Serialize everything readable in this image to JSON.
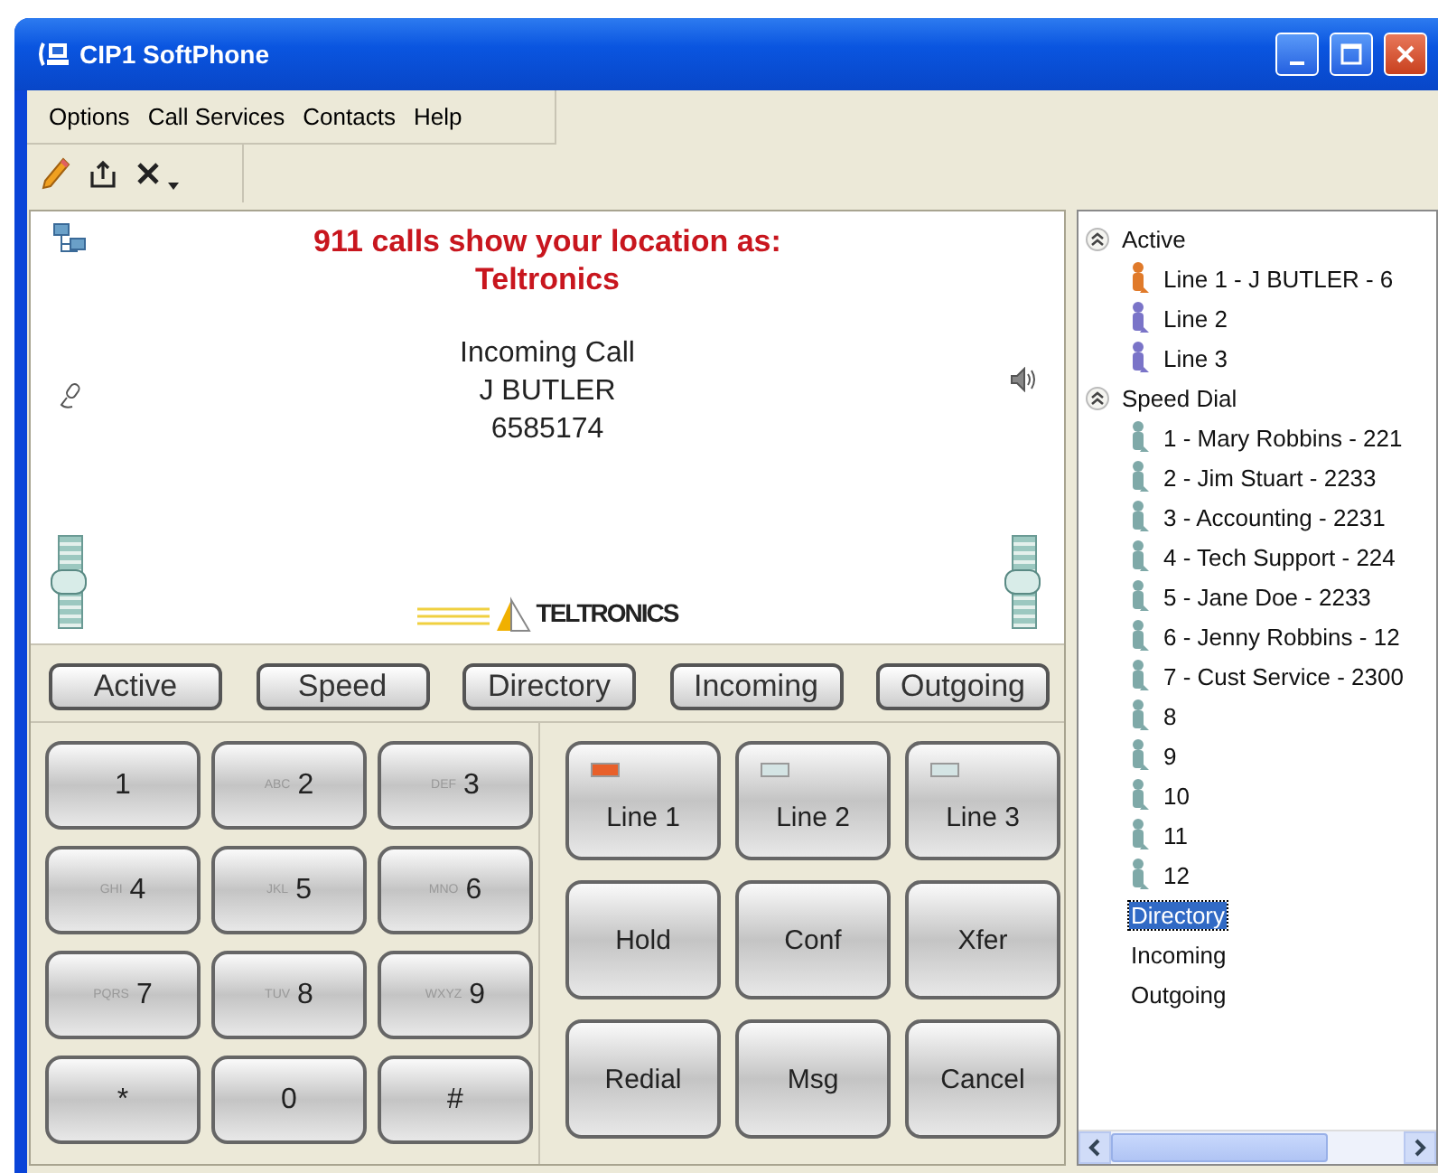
{
  "window": {
    "title": "CIP1 SoftPhone"
  },
  "menu": [
    "Options",
    "Call Services",
    "Contacts",
    "Help"
  ],
  "display": {
    "notice": "911 calls show your location as:",
    "location": "Teltronics",
    "status": "Incoming Call",
    "caller": "J BUTLER",
    "number": "6585174",
    "logo": "TELTRONICS",
    "mic_slider": {
      "level": 0.5
    },
    "speaker_slider": {
      "level": 0.5
    }
  },
  "view_buttons": [
    "Active",
    "Speed",
    "Directory",
    "Incoming",
    "Outgoing"
  ],
  "keypad": [
    {
      "digit": "1"
    },
    {
      "digit": "2",
      "letters": "ABC"
    },
    {
      "digit": "3",
      "letters": "DEF"
    },
    {
      "digit": "4",
      "letters": "GHI"
    },
    {
      "digit": "5",
      "letters": "JKL"
    },
    {
      "digit": "6",
      "letters": "MNO"
    },
    {
      "digit": "7",
      "letters": "PQRS"
    },
    {
      "digit": "8",
      "letters": "TUV"
    },
    {
      "digit": "9",
      "letters": "WXYZ"
    },
    {
      "digit": "*"
    },
    {
      "digit": "0"
    },
    {
      "digit": "#"
    }
  ],
  "line_buttons": [
    {
      "label": "Line 1",
      "lit": true
    },
    {
      "label": "Line 2",
      "lit": false
    },
    {
      "label": "Line 3",
      "lit": false
    }
  ],
  "call_buttons": [
    "Hold",
    "Conf",
    "Xfer",
    "Redial",
    "Msg",
    "Cancel"
  ],
  "tree": [
    {
      "label": "Active",
      "expanded": true,
      "selected": false,
      "children": [
        {
          "label": "Line 1 - J BUTLER - 6",
          "color": "#e07a2a",
          "selected": false
        },
        {
          "label": "Line 2",
          "color": "#7a74c8",
          "selected": false
        },
        {
          "label": "Line 3",
          "color": "#7a74c8",
          "selected": false
        }
      ]
    },
    {
      "label": "Speed Dial",
      "expanded": true,
      "selected": false,
      "children": [
        {
          "label": "1 - Mary Robbins - 221",
          "color": "#7fa9a8",
          "selected": false
        },
        {
          "label": "2 - Jim Stuart - 2233",
          "color": "#7fa9a8",
          "selected": false
        },
        {
          "label": "3 - Accounting - 2231",
          "color": "#7fa9a8",
          "selected": false
        },
        {
          "label": "4 - Tech Support - 224",
          "color": "#7fa9a8",
          "selected": false
        },
        {
          "label": "5 - Jane Doe - 2233",
          "color": "#7fa9a8",
          "selected": false
        },
        {
          "label": "6 - Jenny Robbins - 12",
          "color": "#7fa9a8",
          "selected": false
        },
        {
          "label": "7 - Cust Service - 2300",
          "color": "#7fa9a8",
          "selected": false
        },
        {
          "label": "8",
          "color": "#7fa9a8",
          "selected": false
        },
        {
          "label": "9",
          "color": "#7fa9a8",
          "selected": false
        },
        {
          "label": "10",
          "color": "#7fa9a8",
          "selected": false
        },
        {
          "label": "11",
          "color": "#7fa9a8",
          "selected": false
        },
        {
          "label": "12",
          "color": "#7fa9a8",
          "selected": false
        }
      ]
    },
    {
      "label": "Directory",
      "selected": true
    },
    {
      "label": "Incoming",
      "selected": false
    },
    {
      "label": "Outgoing",
      "selected": false
    }
  ]
}
